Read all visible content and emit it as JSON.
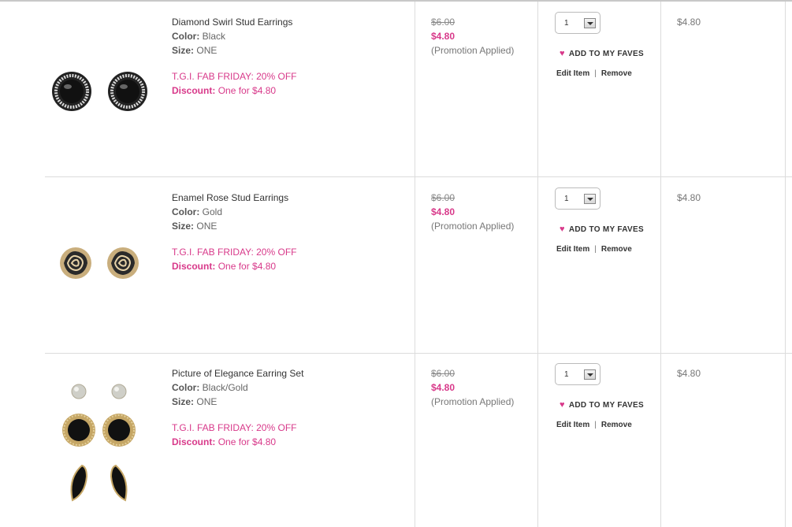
{
  "cart": {
    "items": [
      {
        "name": "Diamond Swirl Stud Earrings",
        "color_label": "Color:",
        "color": "Black",
        "size_label": "Size:",
        "size": "ONE",
        "promotion": "T.G.I. FAB FRIDAY: 20% OFF",
        "discount_label": "Discount:",
        "discount": "One for $4.80",
        "original_price": "$6.00",
        "sale_price": "$4.80",
        "promo_note": "(Promotion Applied)",
        "quantity": "1",
        "faves_label": "ADD TO MY FAVES",
        "edit_label": "Edit Item",
        "separator": "|",
        "remove_label": "Remove",
        "total": "$4.80"
      },
      {
        "name": "Enamel Rose Stud Earrings",
        "color_label": "Color:",
        "color": "Gold",
        "size_label": "Size:",
        "size": "ONE",
        "promotion": "T.G.I. FAB FRIDAY: 20% OFF",
        "discount_label": "Discount:",
        "discount": "One for $4.80",
        "original_price": "$6.00",
        "sale_price": "$4.80",
        "promo_note": "(Promotion Applied)",
        "quantity": "1",
        "faves_label": "ADD TO MY FAVES",
        "edit_label": "Edit Item",
        "separator": "|",
        "remove_label": "Remove",
        "total": "$4.80"
      },
      {
        "name": "Picture of Elegance Earring Set",
        "color_label": "Color:",
        "color": "Black/Gold",
        "size_label": "Size:",
        "size": "ONE",
        "promotion": "T.G.I. FAB FRIDAY: 20% OFF",
        "discount_label": "Discount:",
        "discount": "One for $4.80",
        "original_price": "$6.00",
        "sale_price": "$4.80",
        "promo_note": "(Promotion Applied)",
        "quantity": "1",
        "faves_label": "ADD TO MY FAVES",
        "edit_label": "Edit Item",
        "separator": "|",
        "remove_label": "Remove",
        "total": "$4.80"
      }
    ]
  },
  "icons": {
    "heart": "heart-icon",
    "dropdown": "chevron-down-icon"
  },
  "colors": {
    "accent": "#d8398a",
    "border": "#dcdcdc",
    "text": "#555555"
  }
}
